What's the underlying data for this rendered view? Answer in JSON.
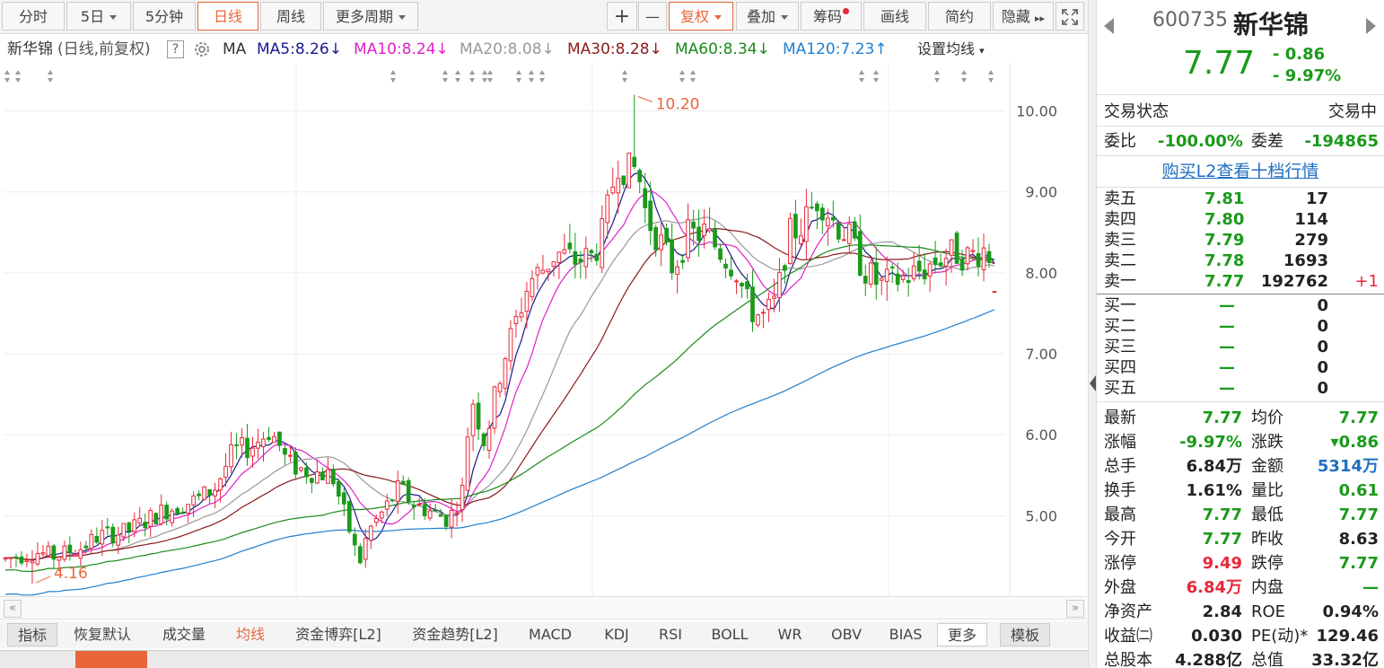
{
  "toolbar": {
    "periods": [
      {
        "label": "分时",
        "active": false,
        "dropdown": false
      },
      {
        "label": "5日",
        "active": false,
        "dropdown": true
      },
      {
        "label": "5分钟",
        "active": false,
        "dropdown": false
      },
      {
        "label": "日线",
        "active": true,
        "dropdown": false
      },
      {
        "label": "周线",
        "active": false,
        "dropdown": false
      },
      {
        "label": "更多周期",
        "active": false,
        "dropdown": true
      }
    ],
    "zoom_in": "+",
    "zoom_out": "—",
    "adjust_label": "复权",
    "overlay_label": "叠加",
    "chips_label": "筹码",
    "draw_label": "画线",
    "simple_label": "简约",
    "hide_label": "隐藏",
    "hide_arrows": "▸▸",
    "fullscreen_icon": "fullscreen-icon"
  },
  "ma_bar": {
    "name": "新华锦",
    "mode": "(日线,前复权)",
    "help": "?",
    "ma_label": "MA",
    "items": [
      {
        "label": "MA5:8.26",
        "arrow": "↓",
        "color": "#1a1a8c"
      },
      {
        "label": "MA10:8.24",
        "arrow": "↓",
        "color": "#e020c8"
      },
      {
        "label": "MA20:8.08",
        "arrow": "↓",
        "color": "#999999"
      },
      {
        "label": "MA30:8.28",
        "arrow": "↓",
        "color": "#8b1a1a"
      },
      {
        "label": "MA60:8.34",
        "arrow": "↓",
        "color": "#1a8a1a"
      },
      {
        "label": "MA120:7.23",
        "arrow": "↑",
        "color": "#1f7fd0"
      }
    ],
    "settings_label": "设置均线"
  },
  "chart_data": {
    "type": "candlestick",
    "title": "",
    "ylim": [
      4.05,
      10.35
    ],
    "y_ticks": [
      "10.00",
      "9.00",
      "8.00",
      "7.00",
      "6.00",
      "5.00"
    ],
    "annotations": [
      {
        "text": "10.20",
        "value": 10.2
      },
      {
        "text": "4.16",
        "value": 4.16
      }
    ],
    "up_color": "#e8283a",
    "down_color": "#1a9a1a",
    "last_price_value": 7.77
  },
  "indicators": {
    "items": [
      "指标",
      "恢复默认",
      "成交量",
      "均线",
      "资金博弈[L2]",
      "资金趋势[L2]",
      "MACD",
      "KDJ",
      "RSI",
      "BOLL",
      "WR",
      "OBV",
      "BIAS",
      "更多",
      "模板"
    ],
    "active": "均线"
  },
  "quote": {
    "code": "600735",
    "name": "新华锦",
    "price": "7.77",
    "change": "- 0.86",
    "change_pct": "- 9.97%",
    "trade_status_label": "交易状态",
    "trade_status": "交易中",
    "committee_ratio_label": "委比",
    "committee_ratio": "-100.00%",
    "committee_diff_label": "委差",
    "committee_diff": "-194865",
    "l2_link": "购买L2查看十档行情",
    "sells": [
      {
        "label": "卖五",
        "price": "7.81",
        "volume": "17",
        "delta": ""
      },
      {
        "label": "卖四",
        "price": "7.80",
        "volume": "114",
        "delta": ""
      },
      {
        "label": "卖三",
        "price": "7.79",
        "volume": "279",
        "delta": ""
      },
      {
        "label": "卖二",
        "price": "7.78",
        "volume": "1693",
        "delta": ""
      },
      {
        "label": "卖一",
        "price": "7.77",
        "volume": "192762",
        "delta": "+1"
      }
    ],
    "buys": [
      {
        "label": "买一",
        "price": "—",
        "volume": "0"
      },
      {
        "label": "买二",
        "price": "—",
        "volume": "0"
      },
      {
        "label": "买三",
        "price": "—",
        "volume": "0"
      },
      {
        "label": "买四",
        "price": "—",
        "volume": "0"
      },
      {
        "label": "买五",
        "price": "—",
        "volume": "0"
      }
    ],
    "stats": [
      {
        "l1": "最新",
        "v1": "7.77",
        "c1": "green",
        "l2": "均价",
        "v2": "7.77",
        "c2": "green"
      },
      {
        "l1": "涨幅",
        "v1": "-9.97%",
        "c1": "green",
        "l2": "涨跌",
        "v2": "▾0.86",
        "c2": "green"
      },
      {
        "l1": "总手",
        "v1": "6.84万",
        "c1": "dark",
        "l2": "金额",
        "v2": "5314万",
        "c2": "blue"
      },
      {
        "l1": "换手",
        "v1": "1.61%",
        "c1": "dark",
        "l2": "量比",
        "v2": "0.61",
        "c2": "green"
      },
      {
        "l1": "最高",
        "v1": "7.77",
        "c1": "green",
        "l2": "最低",
        "v2": "7.77",
        "c2": "green"
      },
      {
        "l1": "今开",
        "v1": "7.77",
        "c1": "green",
        "l2": "昨收",
        "v2": "8.63",
        "c2": "dark"
      },
      {
        "l1": "涨停",
        "v1": "9.49",
        "c1": "red",
        "l2": "跌停",
        "v2": "7.77",
        "c2": "green"
      },
      {
        "l1": "外盘",
        "v1": "6.84万",
        "c1": "red",
        "l2": "内盘",
        "v2": "—",
        "c2": "green"
      },
      {
        "l1": "净资产",
        "v1": "2.84",
        "c1": "dark",
        "l2": "ROE",
        "v2": "0.94%",
        "c2": "dark"
      },
      {
        "l1": "收益㈡",
        "v1": "0.030",
        "c1": "dark",
        "l2": "PE(动)*",
        "v2": "129.46",
        "c2": "dark"
      },
      {
        "l1": "总股本",
        "v1": "4.288亿",
        "c1": "dark",
        "l2": "总值",
        "v2": "33.32亿",
        "c2": "dark"
      }
    ]
  }
}
